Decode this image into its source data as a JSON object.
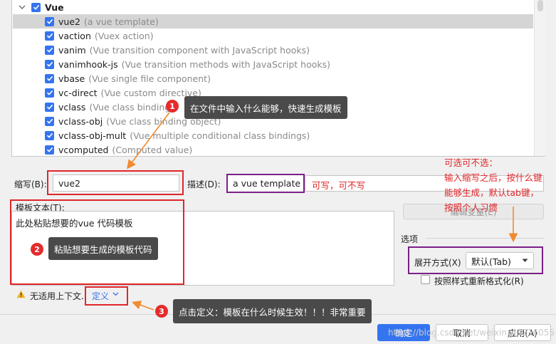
{
  "template_list": {
    "group": {
      "label": "Vue",
      "checked": true
    },
    "items": [
      {
        "abbr": "vue2",
        "desc": "(a vue template)"
      },
      {
        "abbr": "vaction",
        "desc": "(Vuex action)"
      },
      {
        "abbr": "vanim",
        "desc": "(Vue transition component with JavaScript hooks)"
      },
      {
        "abbr": "vanimhook-js",
        "desc": "(Vue transition methods with JavaScript hooks)"
      },
      {
        "abbr": "vbase",
        "desc": "(Vue single file component)"
      },
      {
        "abbr": "vc-direct",
        "desc": "(Vue custom directive)"
      },
      {
        "abbr": "vclass",
        "desc": "(Vue class binding)"
      },
      {
        "abbr": "vclass-obj",
        "desc": "(Vue class binding object)"
      },
      {
        "abbr": "vclass-obj-mult",
        "desc": "(Vue multiple conditional class bindings)"
      },
      {
        "abbr": "vcomputed",
        "desc": "(Computed value)"
      }
    ]
  },
  "form": {
    "abbreviation_label": "缩写(B):",
    "abbreviation_value": "vue2",
    "description_label": "描述(D):",
    "description_value": "a vue template",
    "template_text_label": "模板文本(T):",
    "template_text_value": "此处粘贴想要的vue 代码模板",
    "edit_variables_label": "编辑变量(E)",
    "options_label": "选项",
    "expand_label": "展开方式(X)",
    "expand_value": "默认(Tab)",
    "reformat_label": "按照样式重新格式化(R)",
    "context_warning": "无适用上下文.",
    "define_link": "定义"
  },
  "buttons": {
    "ok": "确定",
    "cancel": "取消",
    "apply": "应用(A)"
  },
  "annotations": {
    "badge1": "1",
    "callout1": "在文件中输入什么能够，快速生成模板",
    "badge2": "2",
    "callout2": "粘贴想要生成的模板代码",
    "badge3": "3",
    "callout3": "点击定义：模板在什么时候生效！！！非常重要",
    "optional_note": "可写，可不写",
    "note_line1": "可选可不选：",
    "note_line2": "输入缩写之后，按什么键",
    "note_line3": "能够生成，默认tab键，",
    "note_line4": "按照个人习惯"
  },
  "watermark": "https://blog.csdn.net/weixin_43216055",
  "colors": {
    "accent": "#3574f0",
    "annotation_red": "#e0262a",
    "annotation_purple": "#7b1f86",
    "annotation_orange": "#f28a2e",
    "callout_bg": "#4a4a4a"
  }
}
